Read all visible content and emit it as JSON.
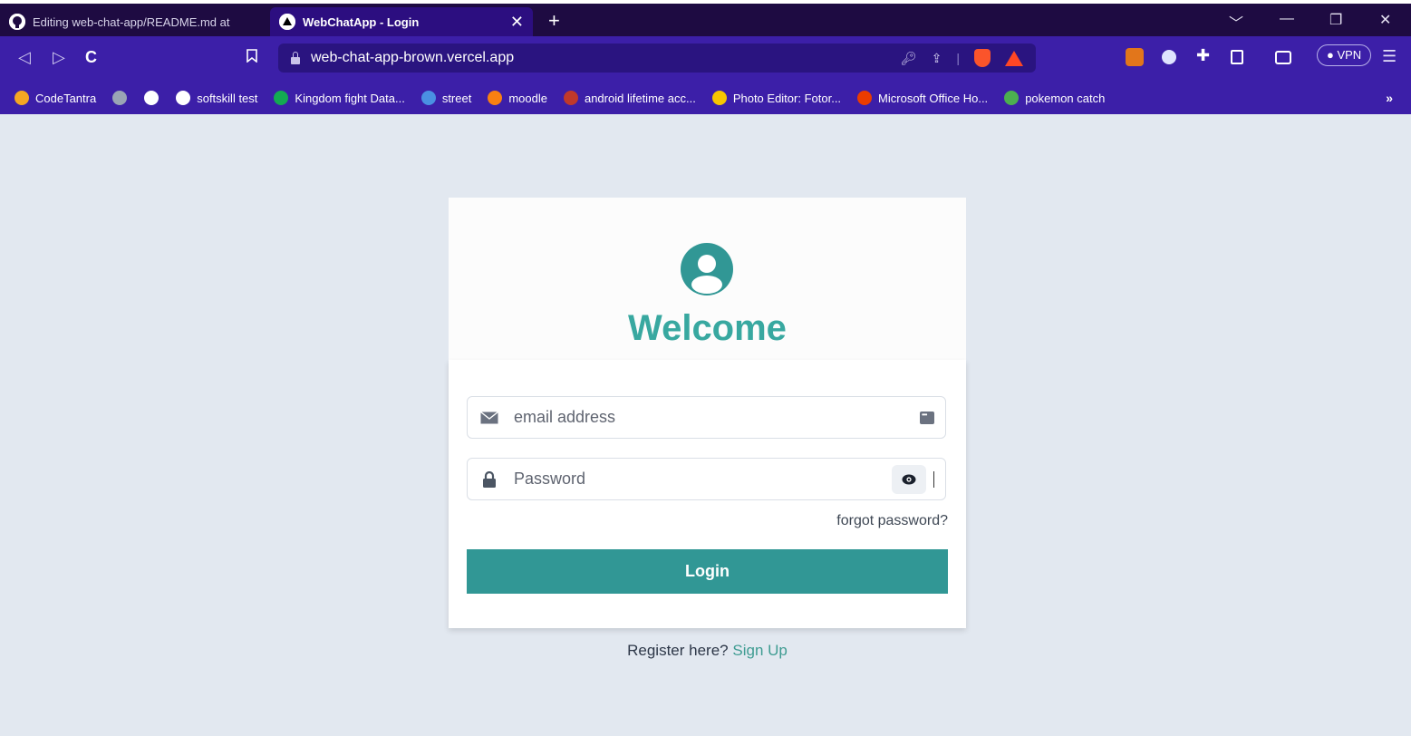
{
  "browser": {
    "tabs": [
      {
        "label": "Editing web-chat-app/README.md at",
        "active": false
      },
      {
        "label": "WebChatApp - Login",
        "active": true
      }
    ],
    "url": "web-chat-app-brown.vercel.app",
    "vpn_label": "VPN",
    "bookmarks_more": "»",
    "bookmarks": [
      {
        "label": "CodeTantra",
        "icon": "sun-icon",
        "color": "#f5a623"
      },
      {
        "label": "",
        "icon": "image-icon",
        "color": "#9aa4b5"
      },
      {
        "label": "",
        "icon": "globe-icon",
        "color": "#ffffff"
      },
      {
        "label": "softskill test",
        "icon": "globe-icon",
        "color": "#ffffff"
      },
      {
        "label": "Kingdom fight Data...",
        "icon": "mongodb-leaf-icon",
        "color": "#13aa52"
      },
      {
        "label": "street",
        "icon": "globe-blue-icon",
        "color": "#4a90e2"
      },
      {
        "label": "moodle",
        "icon": "moodle-icon",
        "color": "#f98012"
      },
      {
        "label": "android lifetime acc...",
        "icon": "avatar-icon",
        "color": "#c0392b"
      },
      {
        "label": "Photo Editor: Fotor...",
        "icon": "fotor-icon",
        "color": "#f7c600"
      },
      {
        "label": "Microsoft Office Ho...",
        "icon": "office-icon",
        "color": "#eb3c00"
      },
      {
        "label": "pokemon catch",
        "icon": "pokemon-icon",
        "color": "#4caf50"
      }
    ]
  },
  "login": {
    "title": "Welcome",
    "email_placeholder": "email address",
    "password_placeholder": "Password",
    "forgot": "forgot password?",
    "button": "Login",
    "register_text": "Register here?",
    "signup_link": "Sign Up"
  },
  "colors": {
    "accent": "#319795",
    "title": "#38a8a0",
    "page_bg": "#e2e8f0",
    "browser_chrome": "#3c1fa8"
  }
}
